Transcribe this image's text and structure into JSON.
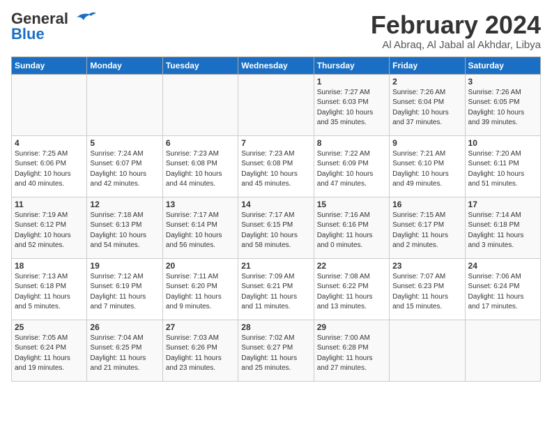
{
  "header": {
    "logo_line1": "General",
    "logo_line2": "Blue",
    "title": "February 2024",
    "subtitle": "Al Abraq, Al Jabal al Akhdar, Libya"
  },
  "weekdays": [
    "Sunday",
    "Monday",
    "Tuesday",
    "Wednesday",
    "Thursday",
    "Friday",
    "Saturday"
  ],
  "weeks": [
    [
      {
        "day": "",
        "detail": ""
      },
      {
        "day": "",
        "detail": ""
      },
      {
        "day": "",
        "detail": ""
      },
      {
        "day": "",
        "detail": ""
      },
      {
        "day": "1",
        "detail": "Sunrise: 7:27 AM\nSunset: 6:03 PM\nDaylight: 10 hours\nand 35 minutes."
      },
      {
        "day": "2",
        "detail": "Sunrise: 7:26 AM\nSunset: 6:04 PM\nDaylight: 10 hours\nand 37 minutes."
      },
      {
        "day": "3",
        "detail": "Sunrise: 7:26 AM\nSunset: 6:05 PM\nDaylight: 10 hours\nand 39 minutes."
      }
    ],
    [
      {
        "day": "4",
        "detail": "Sunrise: 7:25 AM\nSunset: 6:06 PM\nDaylight: 10 hours\nand 40 minutes."
      },
      {
        "day": "5",
        "detail": "Sunrise: 7:24 AM\nSunset: 6:07 PM\nDaylight: 10 hours\nand 42 minutes."
      },
      {
        "day": "6",
        "detail": "Sunrise: 7:23 AM\nSunset: 6:08 PM\nDaylight: 10 hours\nand 44 minutes."
      },
      {
        "day": "7",
        "detail": "Sunrise: 7:23 AM\nSunset: 6:08 PM\nDaylight: 10 hours\nand 45 minutes."
      },
      {
        "day": "8",
        "detail": "Sunrise: 7:22 AM\nSunset: 6:09 PM\nDaylight: 10 hours\nand 47 minutes."
      },
      {
        "day": "9",
        "detail": "Sunrise: 7:21 AM\nSunset: 6:10 PM\nDaylight: 10 hours\nand 49 minutes."
      },
      {
        "day": "10",
        "detail": "Sunrise: 7:20 AM\nSunset: 6:11 PM\nDaylight: 10 hours\nand 51 minutes."
      }
    ],
    [
      {
        "day": "11",
        "detail": "Sunrise: 7:19 AM\nSunset: 6:12 PM\nDaylight: 10 hours\nand 52 minutes."
      },
      {
        "day": "12",
        "detail": "Sunrise: 7:18 AM\nSunset: 6:13 PM\nDaylight: 10 hours\nand 54 minutes."
      },
      {
        "day": "13",
        "detail": "Sunrise: 7:17 AM\nSunset: 6:14 PM\nDaylight: 10 hours\nand 56 minutes."
      },
      {
        "day": "14",
        "detail": "Sunrise: 7:17 AM\nSunset: 6:15 PM\nDaylight: 10 hours\nand 58 minutes."
      },
      {
        "day": "15",
        "detail": "Sunrise: 7:16 AM\nSunset: 6:16 PM\nDaylight: 11 hours\nand 0 minutes."
      },
      {
        "day": "16",
        "detail": "Sunrise: 7:15 AM\nSunset: 6:17 PM\nDaylight: 11 hours\nand 2 minutes."
      },
      {
        "day": "17",
        "detail": "Sunrise: 7:14 AM\nSunset: 6:18 PM\nDaylight: 11 hours\nand 3 minutes."
      }
    ],
    [
      {
        "day": "18",
        "detail": "Sunrise: 7:13 AM\nSunset: 6:18 PM\nDaylight: 11 hours\nand 5 minutes."
      },
      {
        "day": "19",
        "detail": "Sunrise: 7:12 AM\nSunset: 6:19 PM\nDaylight: 11 hours\nand 7 minutes."
      },
      {
        "day": "20",
        "detail": "Sunrise: 7:11 AM\nSunset: 6:20 PM\nDaylight: 11 hours\nand 9 minutes."
      },
      {
        "day": "21",
        "detail": "Sunrise: 7:09 AM\nSunset: 6:21 PM\nDaylight: 11 hours\nand 11 minutes."
      },
      {
        "day": "22",
        "detail": "Sunrise: 7:08 AM\nSunset: 6:22 PM\nDaylight: 11 hours\nand 13 minutes."
      },
      {
        "day": "23",
        "detail": "Sunrise: 7:07 AM\nSunset: 6:23 PM\nDaylight: 11 hours\nand 15 minutes."
      },
      {
        "day": "24",
        "detail": "Sunrise: 7:06 AM\nSunset: 6:24 PM\nDaylight: 11 hours\nand 17 minutes."
      }
    ],
    [
      {
        "day": "25",
        "detail": "Sunrise: 7:05 AM\nSunset: 6:24 PM\nDaylight: 11 hours\nand 19 minutes."
      },
      {
        "day": "26",
        "detail": "Sunrise: 7:04 AM\nSunset: 6:25 PM\nDaylight: 11 hours\nand 21 minutes."
      },
      {
        "day": "27",
        "detail": "Sunrise: 7:03 AM\nSunset: 6:26 PM\nDaylight: 11 hours\nand 23 minutes."
      },
      {
        "day": "28",
        "detail": "Sunrise: 7:02 AM\nSunset: 6:27 PM\nDaylight: 11 hours\nand 25 minutes."
      },
      {
        "day": "29",
        "detail": "Sunrise: 7:00 AM\nSunset: 6:28 PM\nDaylight: 11 hours\nand 27 minutes."
      },
      {
        "day": "",
        "detail": ""
      },
      {
        "day": "",
        "detail": ""
      }
    ]
  ]
}
